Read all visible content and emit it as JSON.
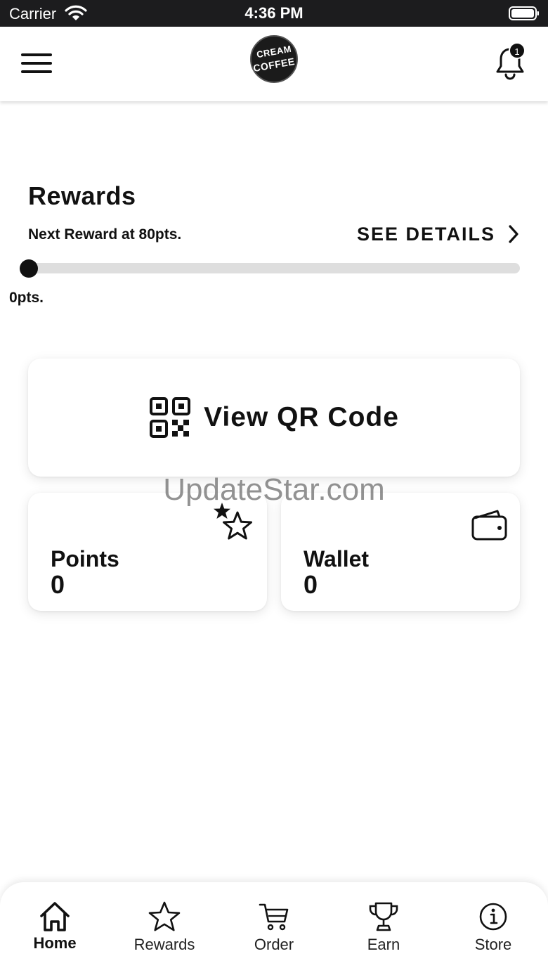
{
  "status_bar": {
    "carrier": "Carrier",
    "time": "4:36 PM"
  },
  "header": {
    "logo_line1": "CREAM",
    "logo_line2": "COFFEE",
    "notification_count": "1"
  },
  "rewards": {
    "title": "Rewards",
    "next_reward": "Next Reward at 80pts.",
    "see_details": "SEE DETAILS",
    "current_points_label": "0pts.",
    "progress_fraction": 0
  },
  "qr": {
    "label": "View QR Code"
  },
  "points_card": {
    "title": "Points",
    "value": "0"
  },
  "wallet_card": {
    "title": "Wallet",
    "value": "0"
  },
  "watermark": "UpdateStar.com",
  "bottom_nav": {
    "items": [
      {
        "label": "Home",
        "icon": "home-icon",
        "active": true
      },
      {
        "label": "Rewards",
        "icon": "star-icon",
        "active": false
      },
      {
        "label": "Order",
        "icon": "cart-icon",
        "active": false
      },
      {
        "label": "Earn",
        "icon": "trophy-icon",
        "active": false
      },
      {
        "label": "Store",
        "icon": "info-icon",
        "active": false
      }
    ]
  },
  "colors": {
    "primary": "#111111",
    "track": "#dedede",
    "status_bar": "#1c1c1e"
  }
}
